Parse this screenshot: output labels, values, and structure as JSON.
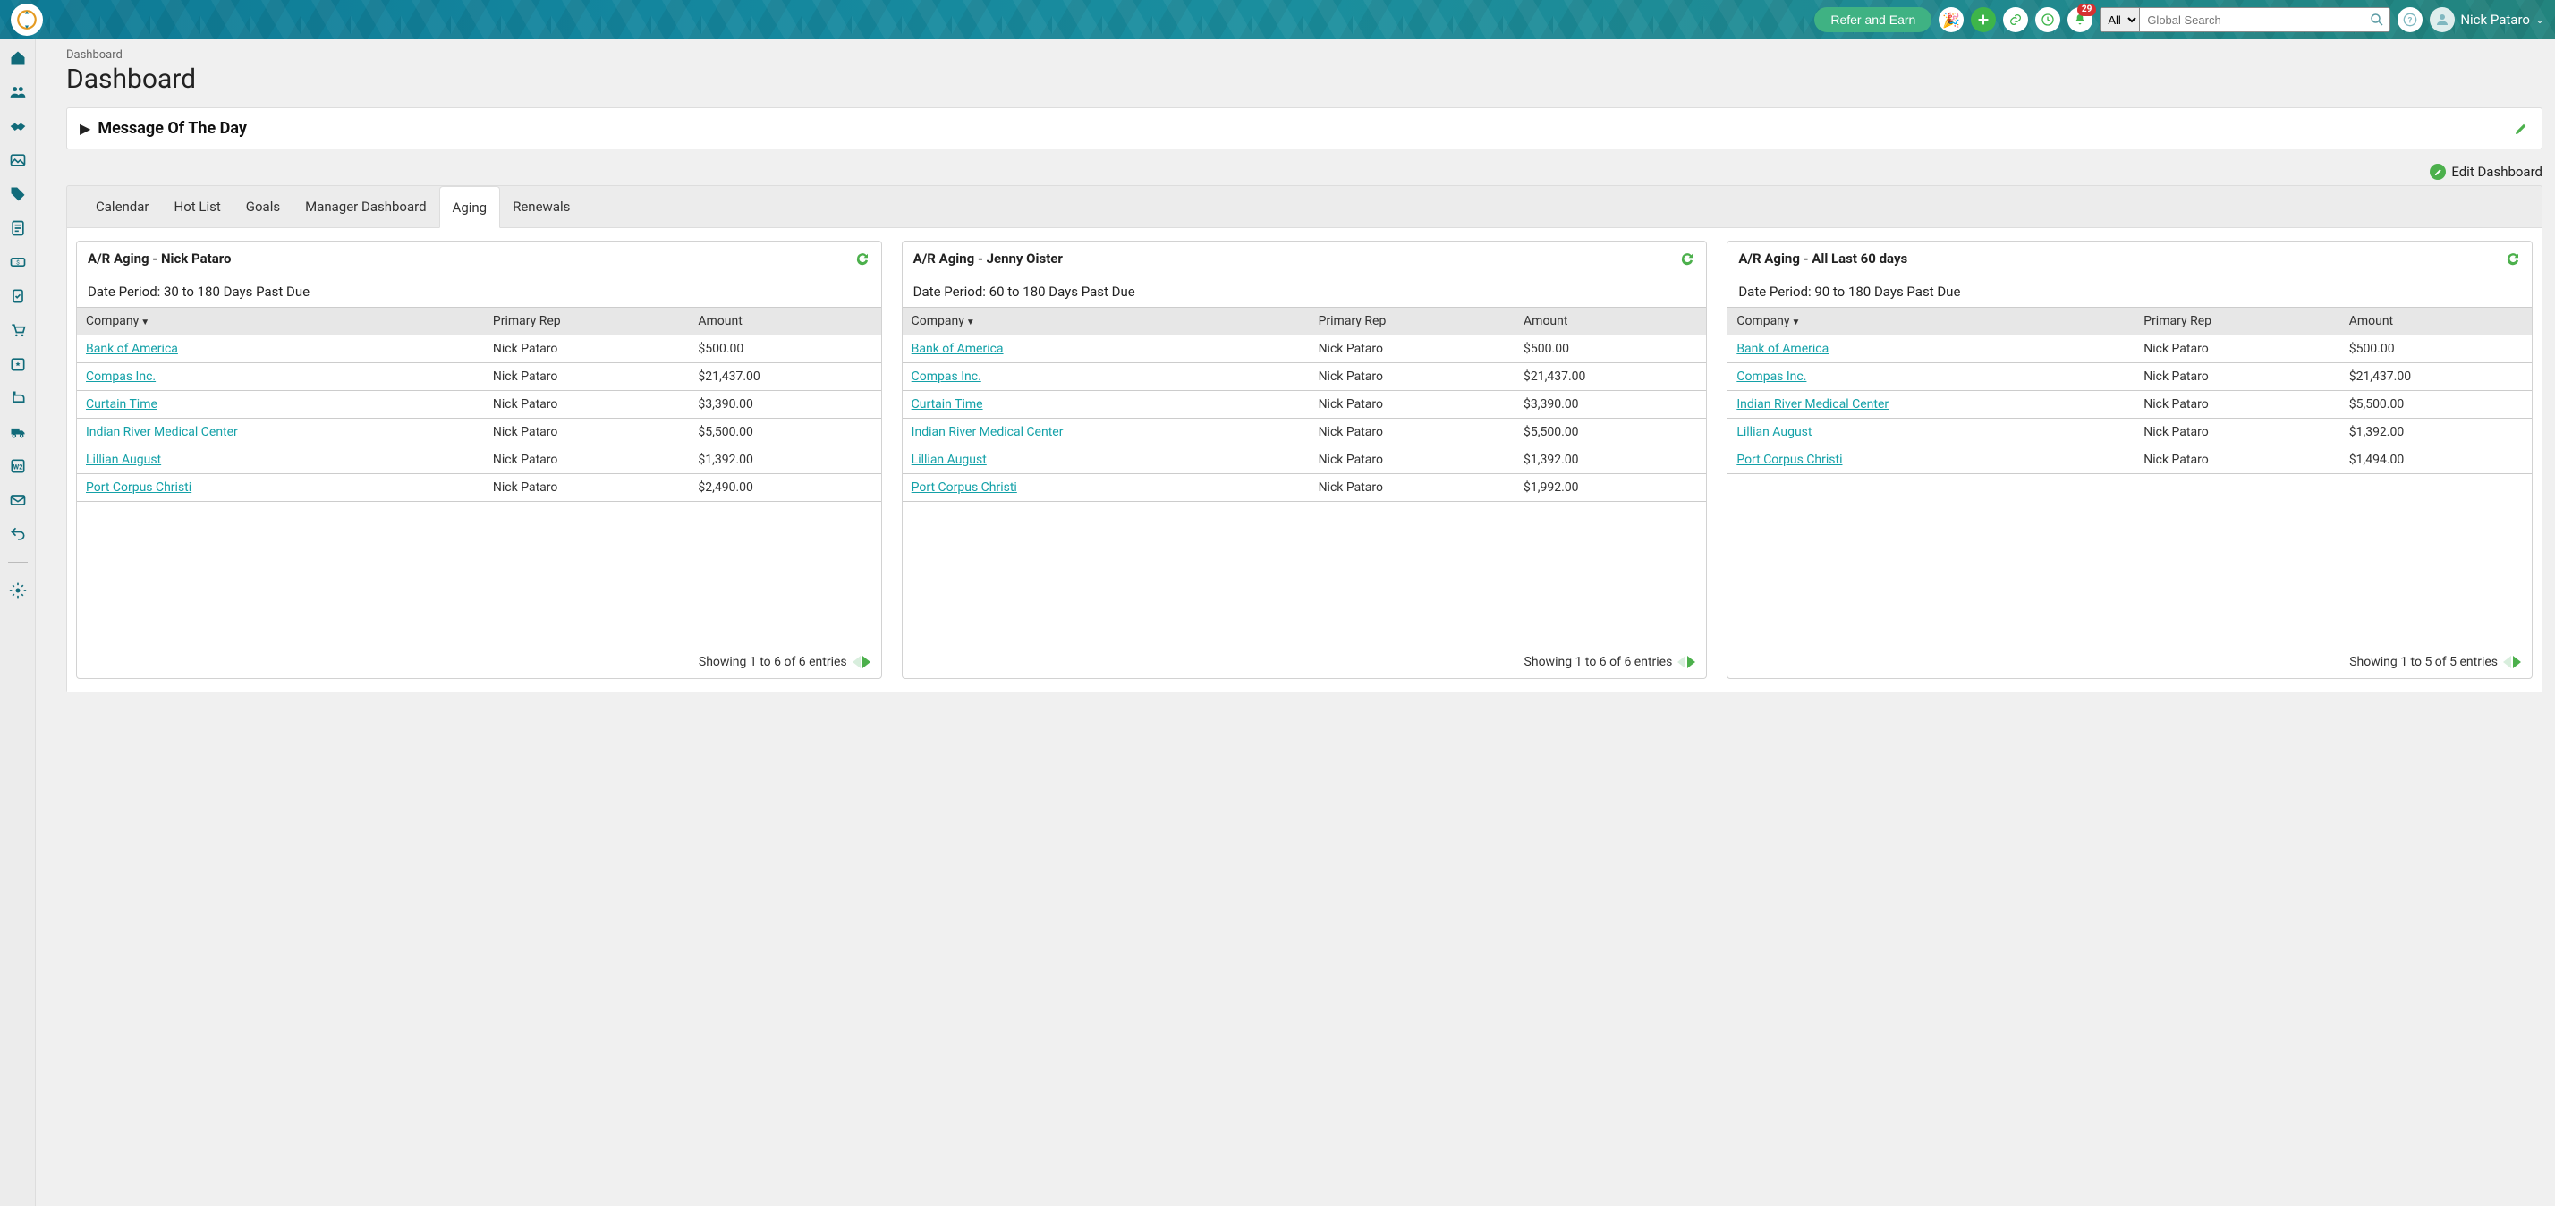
{
  "header": {
    "refer_label": "Refer and Earn",
    "notif_count": "29",
    "scope": "All",
    "search_placeholder": "Global Search",
    "user_name": "Nick Pataro"
  },
  "breadcrumb": "Dashboard",
  "page_title": "Dashboard",
  "motd": {
    "title": "Message Of The Day"
  },
  "edit_dashboard_label": "Edit Dashboard",
  "tabs": [
    "Calendar",
    "Hot List",
    "Goals",
    "Manager Dashboard",
    "Aging",
    "Renewals"
  ],
  "active_tab_index": 4,
  "columns": {
    "company": "Company",
    "primary_rep": "Primary Rep",
    "amount": "Amount"
  },
  "widgets": [
    {
      "title": "A/R Aging - Nick Pataro",
      "date_period": "Date Period: 30 to 180 Days Past Due",
      "rows": [
        {
          "company": "Bank of America",
          "rep": "Nick Pataro",
          "amount": "$500.00"
        },
        {
          "company": "Compas Inc.",
          "rep": "Nick Pataro",
          "amount": "$21,437.00"
        },
        {
          "company": "Curtain Time",
          "rep": "Nick Pataro",
          "amount": "$3,390.00"
        },
        {
          "company": "Indian River Medical Center",
          "rep": "Nick Pataro",
          "amount": "$5,500.00"
        },
        {
          "company": "Lillian August",
          "rep": "Nick Pataro",
          "amount": "$1,392.00"
        },
        {
          "company": "Port Corpus Christi",
          "rep": "Nick Pataro",
          "amount": "$2,490.00"
        }
      ],
      "footer": "Showing 1 to 6 of 6 entries"
    },
    {
      "title": "A/R Aging - Jenny Oister",
      "date_period": "Date Period: 60 to 180 Days Past Due",
      "rows": [
        {
          "company": "Bank of America",
          "rep": "Nick Pataro",
          "amount": "$500.00"
        },
        {
          "company": "Compas Inc.",
          "rep": "Nick Pataro",
          "amount": "$21,437.00"
        },
        {
          "company": "Curtain Time",
          "rep": "Nick Pataro",
          "amount": "$3,390.00"
        },
        {
          "company": "Indian River Medical Center",
          "rep": "Nick Pataro",
          "amount": "$5,500.00"
        },
        {
          "company": "Lillian August",
          "rep": "Nick Pataro",
          "amount": "$1,392.00"
        },
        {
          "company": "Port Corpus Christi",
          "rep": "Nick Pataro",
          "amount": "$1,992.00"
        }
      ],
      "footer": "Showing 1 to 6 of 6 entries"
    },
    {
      "title": "A/R Aging - All Last 60 days",
      "date_period": "Date Period: 90 to 180 Days Past Due",
      "rows": [
        {
          "company": "Bank of America",
          "rep": "Nick Pataro",
          "amount": "$500.00"
        },
        {
          "company": "Compas Inc.",
          "rep": "Nick Pataro",
          "amount": "$21,437.00"
        },
        {
          "company": "Indian River Medical Center",
          "rep": "Nick Pataro",
          "amount": "$5,500.00"
        },
        {
          "company": "Lillian August",
          "rep": "Nick Pataro",
          "amount": "$1,392.00"
        },
        {
          "company": "Port Corpus Christi",
          "rep": "Nick Pataro",
          "amount": "$1,494.00"
        }
      ],
      "footer": "Showing 1 to 5 of 5 entries"
    }
  ]
}
